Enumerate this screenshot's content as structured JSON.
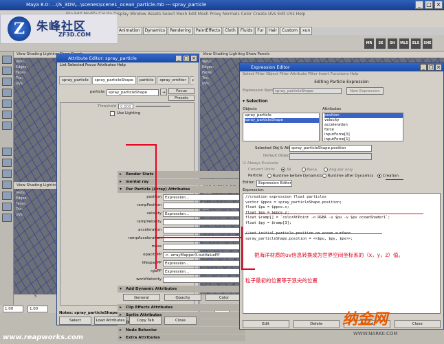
{
  "app": {
    "title": "Maya 8.0: ...\\iS_3DS\\...\\scenes\\scene1_ocean_particle.mb  ---  spray_particle",
    "menu": [
      "File",
      "Edit",
      "Modify",
      "Create",
      "Display",
      "Window",
      "Assets",
      "Select",
      "Mesh",
      "Edit Mesh",
      "Proxy",
      "Normals",
      "Color",
      "Create UVs",
      "Edit UVs",
      "Help"
    ],
    "shelf_tabs": [
      "Animation",
      "Dynamics",
      "Rendering",
      "PaintEffects",
      "Cloth",
      "Fluids",
      "Fur",
      "Hair",
      "Custom",
      "xun"
    ],
    "shelf_buttons": [
      "MR",
      "SE",
      "SH",
      "MLS",
      "ELS",
      "SHE"
    ]
  },
  "logo": {
    "mark": "Z",
    "cn": "朱峰社区",
    "en": "ZF3D.COM"
  },
  "viewport_menu": "View  Shading  Lighting  Show  Panels",
  "viewport_stats": [
    "Verts:",
    "Edges:",
    "Faces:",
    "Tris:",
    "UVs:"
  ],
  "attribute_editor": {
    "title": "Attribute Editor: spray_particle",
    "menu": "List  Selected  Focus  Attributes  Help",
    "tabs": [
      "spray_particle",
      "spray_particleShape",
      "particle",
      "spray_emitter",
      "particleClo"
    ],
    "particle_label": "particle:",
    "particle_value": "spray_particleShape",
    "focus": "Focus",
    "presets": "Presets",
    "threshold_label": "Threshold",
    "threshold_value": "0.000",
    "use_lighting": "Use Lighting",
    "sections_top": [
      "Render Stats",
      "mental ray",
      "Per Particle (Array) Attributes"
    ],
    "pp_rows": [
      {
        "label": "position",
        "value": "Expression..."
      },
      {
        "label": "rampPosition",
        "value": ""
      },
      {
        "label": "velocity",
        "value": "Expression..."
      },
      {
        "label": "rampVelocity",
        "value": ""
      },
      {
        "label": "acceleration",
        "value": ""
      },
      {
        "label": "rampAcceleration",
        "value": ""
      },
      {
        "label": "mass",
        "value": ""
      },
      {
        "label": "opacityPP",
        "value": "<- arrayMapper3.outValuePP"
      },
      {
        "label": "lifespanPP",
        "value": "Expression..."
      },
      {
        "label": "rgbPP",
        "value": "Expression..."
      },
      {
        "label": "worldVelocity",
        "value": ""
      }
    ],
    "add_dynamic": "Add Dynamic Attributes",
    "add_buttons": [
      "General",
      "Opacity",
      "Color"
    ],
    "sections_bottom": [
      "Clip Effects Attributes",
      "Sprite Attributes",
      "Object Display",
      "Node Behavior",
      "Extra Attributes"
    ],
    "notes": "Notes: spray_particleShape",
    "footer_buttons": [
      "Select",
      "Load Attributes",
      "Copy Tab",
      "Close"
    ]
  },
  "expression_editor": {
    "title": "Expression Editor",
    "menu": "Select Filter  Object Filter  Attribute Filter  Insert Functions  Help",
    "header": "Editing Particle Expression",
    "expr_name_label": "Expression Name",
    "expr_name_value": "spray_particleShape",
    "new_expression": "New Expression",
    "selection": "Selection",
    "objects_label": "Objects",
    "attributes_label": "Attributes",
    "objects": [
      "spray_particle",
      "spray_particleShape"
    ],
    "attributes": [
      "position",
      "velocity",
      "acceleration",
      "force",
      "inputForce[0]",
      "inputForce[1]"
    ],
    "selected_label": "Selected Obj & Attr",
    "selected_value": "spray_particleShape.position",
    "default_object": "Default Object",
    "always_evaluate": "Always Evaluate",
    "convert_units": "Convert Units:",
    "units": [
      "All",
      "None",
      "Angular only"
    ],
    "particle_label": "Particle:",
    "particle_opts": [
      "Runtime before Dynamics",
      "Runtime after Dynamics",
      "Creation"
    ],
    "editor_label": "Editor:",
    "editor_value": "Expression Editor",
    "expression_label": "Expression:",
    "code": "//creation expression float particles\nvector $ppos = spray_particleShape.position;\nfloat $pu = $ppos.x;\nfloat $pv = $ppos.z;\nfloat $ramp[] = `colorAtPoint -o RGBA -u $pu -v $pv oceanShader1`;\nfloat $py = $ramp[3];\n\n//set initial particle position on ocean surface\nspray_particleShape.position = <<$pu, $py, $pv>>;",
    "buttons": [
      "Edit",
      "Delete",
      "Reload",
      "Close"
    ]
  },
  "annotations": {
    "note1": "把海洋材质的uv信息转换成为世界空间坐标系的（x，y，z）值。",
    "note2": "粒子最初的位置等于浪尖的位置"
  },
  "timeline": {
    "ticks": [
      "5",
      "10",
      "15",
      "20",
      "25",
      "30",
      "35",
      "40"
    ],
    "start": "1.00",
    "end": "1.00",
    "current": "40"
  },
  "watermarks": {
    "left": "www.reapworks.com",
    "right": "纳金网",
    "right_url": "WWW.NARKII.COM"
  }
}
